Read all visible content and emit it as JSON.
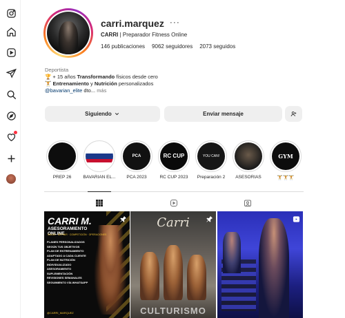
{
  "sidebar": {
    "icons": [
      "instagram-logo-icon",
      "home-icon",
      "reels-icon",
      "direct-messages-icon",
      "search-icon",
      "explore-icon",
      "notifications-heart-icon",
      "create-plus-icon",
      "profile-avatar-icon"
    ]
  },
  "profile": {
    "username": "carri.marquez",
    "more": "···",
    "subtitle_name": "CARRI",
    "subtitle_sep": " | ",
    "subtitle_role": "Preparador Fitness Online",
    "stats": {
      "posts": "146 publicaciones",
      "followers": "9062 seguidores",
      "following": "2073 seguidos"
    },
    "bio": {
      "category": "Deportista",
      "line1_prefix": "🏆 + 15 años ",
      "line1_bold": "Transformando",
      "line1_suffix": " físicos desde cero",
      "line2_prefix": "🏋️ ",
      "line2_bold1": "Entrenamiento",
      "line2_mid": " y ",
      "line2_bold2": "Nutrición",
      "line2_suffix": " personalizados",
      "line3_tag": "@bavarian_elite",
      "line3_text": " dto... ",
      "line3_more": "más"
    }
  },
  "actions": {
    "following_label": "Siguiendo",
    "message_label": "Enviar mensaje"
  },
  "highlights": [
    {
      "label": "PREP 26",
      "cover": ""
    },
    {
      "label": "BAVARIAN EL...",
      "cover": ""
    },
    {
      "label": "PCA 2023",
      "cover": "PCA"
    },
    {
      "label": "RC CUP 2023",
      "cover": "RC CUP"
    },
    {
      "label": "Preparación 2",
      "cover": "YOU CAN!"
    },
    {
      "label": "ASESORIAS",
      "cover": ""
    },
    {
      "label": "🏋️🏋️🏋️",
      "cover": "GYM"
    }
  ],
  "tabs": [
    "posts-grid-tab",
    "reels-tab",
    "tagged-tab"
  ],
  "posts": {
    "p1": {
      "title": "CARRI M.",
      "subtitle": "ASESORAMIENTO ONLINE",
      "small": "SALUD · DEFINIR · COMPETICIÓN · OPERACIONES",
      "items": [
        "PLANES PERSONALIZADOS",
        "SEGÚN TUS OBJETIVOS",
        "PLAN DE ENTRENAMIENTO ADAPTADO A CADA CLIENTE",
        "PLAN DE NUTRICIÓN INDIVIDUALIZADO",
        "ASESORAMIENTO SUPLEMENTACIÓN",
        "REVISIONES SEMANALES",
        "SEGUIMIENTO VÍA WHATSAPP"
      ],
      "foot": "@CARRI_MARQUEZ"
    },
    "p2": {
      "title": "Carri",
      "foot": "CULTURISMO"
    }
  },
  "colors": {
    "accent": "#0095f6",
    "notification": "#ff3040",
    "button_bg": "#efefef",
    "gold": "#f1c232"
  }
}
